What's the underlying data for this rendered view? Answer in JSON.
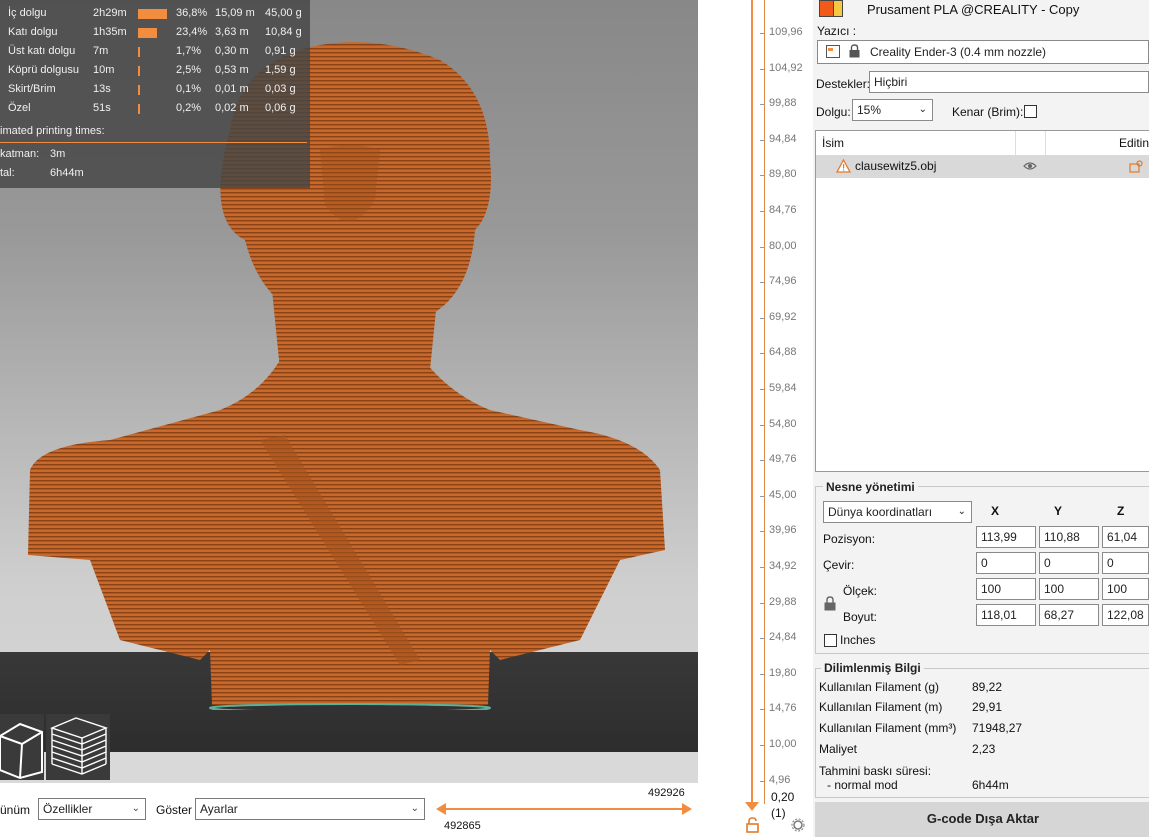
{
  "stats": {
    "rows": [
      {
        "name": "İç dolgu",
        "time": "2h29m",
        "percent": "36,8%",
        "length": "15,09 m",
        "weight": "45,00 g",
        "fraction": 0.368
      },
      {
        "name": "Katı dolgu",
        "time": "1h35m",
        "percent": "23,4%",
        "length": "3,63 m",
        "weight": "10,84 g",
        "fraction": 0.234
      },
      {
        "name": "Üst katı dolgu",
        "time": "7m",
        "percent": "1,7%",
        "length": "0,30 m",
        "weight": "0,91 g",
        "fraction": 0.017
      },
      {
        "name": "Köprü dolgusu",
        "time": "10m",
        "percent": "2,5%",
        "length": "0,53 m",
        "weight": "1,59 g",
        "fraction": 0.025
      },
      {
        "name": "Skirt/Brim",
        "time": "13s",
        "percent": "0,1%",
        "length": "0,01 m",
        "weight": "0,03 g",
        "fraction": 0.001
      },
      {
        "name": "Özel",
        "time": "51s",
        "percent": "0,2%",
        "length": "0,02 m",
        "weight": "0,06 g",
        "fraction": 0.002
      }
    ],
    "estimated_title": "imated printing times:",
    "layer_label": "katman:",
    "layer_value": "3m",
    "total_label": "tal:",
    "total_value": "6h44m",
    "bar_color": "#f28c3f"
  },
  "viewport": {
    "view_icons": [
      "iso-view-icon",
      "layers-view-icon"
    ]
  },
  "bottombar": {
    "view_label": "ünüm",
    "view_value": "Özellikler",
    "show_label": "Göster",
    "show_value": "Ayarlar",
    "hslider_top_value": "492926",
    "hslider_bottom_value": "492865"
  },
  "vslider": {
    "ticks": [
      "109,96",
      "104,92",
      "99,88",
      "94,84",
      "89,80",
      "84,76",
      "80,00",
      "74,96",
      "69,92",
      "64,88",
      "59,84",
      "54,80",
      "49,76",
      "45,00",
      "39,96",
      "34,92",
      "29,88",
      "24,84",
      "19,80",
      "14,76",
      "10,00",
      "4,96"
    ],
    "bottom_value": "0,20",
    "bottom_layer": "(1)",
    "accent": "#f28c3f"
  },
  "panel": {
    "filament": "Prusament PLA @CREALITY - Copy",
    "printer_label": "Yazıcı :",
    "printer": "Creality Ender-3 (0.4 mm nozzle)",
    "supports_label": "Destekler:",
    "supports_value": "Hiçbiri",
    "infill_label": "Dolgu:",
    "infill_value": "15%",
    "brim_label": "Kenar (Brim):",
    "object_list": {
      "col_name": "İsim",
      "col_editing": "Editin",
      "objects": [
        {
          "name": "clausewitz5.obj"
        }
      ]
    },
    "object_manipulation": {
      "title": "Nesne yönetimi",
      "coord_system": "Dünya koordinatları",
      "axes": [
        "X",
        "Y",
        "Z"
      ],
      "position_label": "Pozisyon:",
      "position": [
        "113,99",
        "110,88",
        "61,04"
      ],
      "rotate_label": "Çevir:",
      "rotate": [
        "0",
        "0",
        "0"
      ],
      "scale_label": "Ölçek:",
      "scale": [
        "100",
        "100",
        "100"
      ],
      "size_label": "Boyut:",
      "size": [
        "118,01",
        "68,27",
        "122,08"
      ],
      "inches_label": "Inches"
    },
    "sliced_info": {
      "title": "Dilimlenmiş Bilgi",
      "filament_g_label": "Kullanılan Filament (g)",
      "filament_g": "89,22",
      "filament_m_label": "Kullanılan Filament (m)",
      "filament_m": "29,91",
      "filament_mm3_label": "Kullanılan Filament (mm³)",
      "filament_mm3": "71948,27",
      "cost_label": "Maliyet",
      "cost": "2,23",
      "est_time_label": "Tahmini baskı süresi:",
      "normal_mode_label": "- normal mod",
      "normal_mode_value": "6h44m"
    },
    "export_button": "G-code Dışa Aktar"
  }
}
